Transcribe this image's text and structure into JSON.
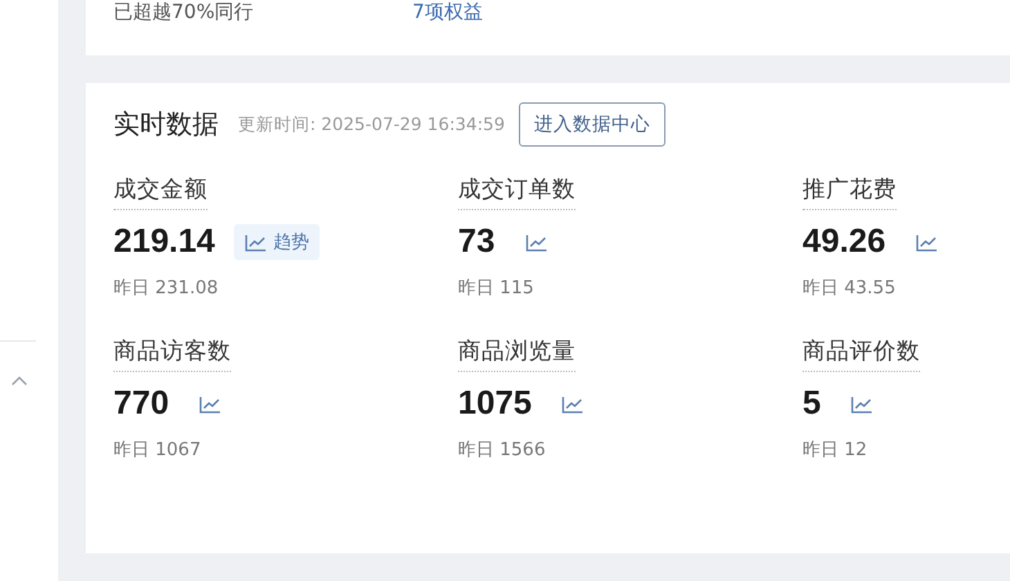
{
  "top_card": {
    "rank_text": "已超越70%同行",
    "benefits_link": "7项权益"
  },
  "realtime": {
    "title": "实时数据",
    "updated": "更新时间: 2025-07-29 16:34:59",
    "button": "进入数据中心",
    "metrics": [
      {
        "label": "成交金额",
        "value": "219.14",
        "trend_label": "趋势",
        "yesterday": "昨日 231.08"
      },
      {
        "label": "成交订单数",
        "value": "73",
        "yesterday": "昨日 115"
      },
      {
        "label": "推广花费",
        "value": "49.26",
        "yesterday": "昨日 43.55"
      },
      {
        "label": "商品访客数",
        "value": "770",
        "yesterday": "昨日 1067"
      },
      {
        "label": "商品浏览量",
        "value": "1075",
        "yesterday": "昨日 1566"
      },
      {
        "label": "商品评价数",
        "value": "5",
        "yesterday": "昨日 12"
      }
    ]
  }
}
